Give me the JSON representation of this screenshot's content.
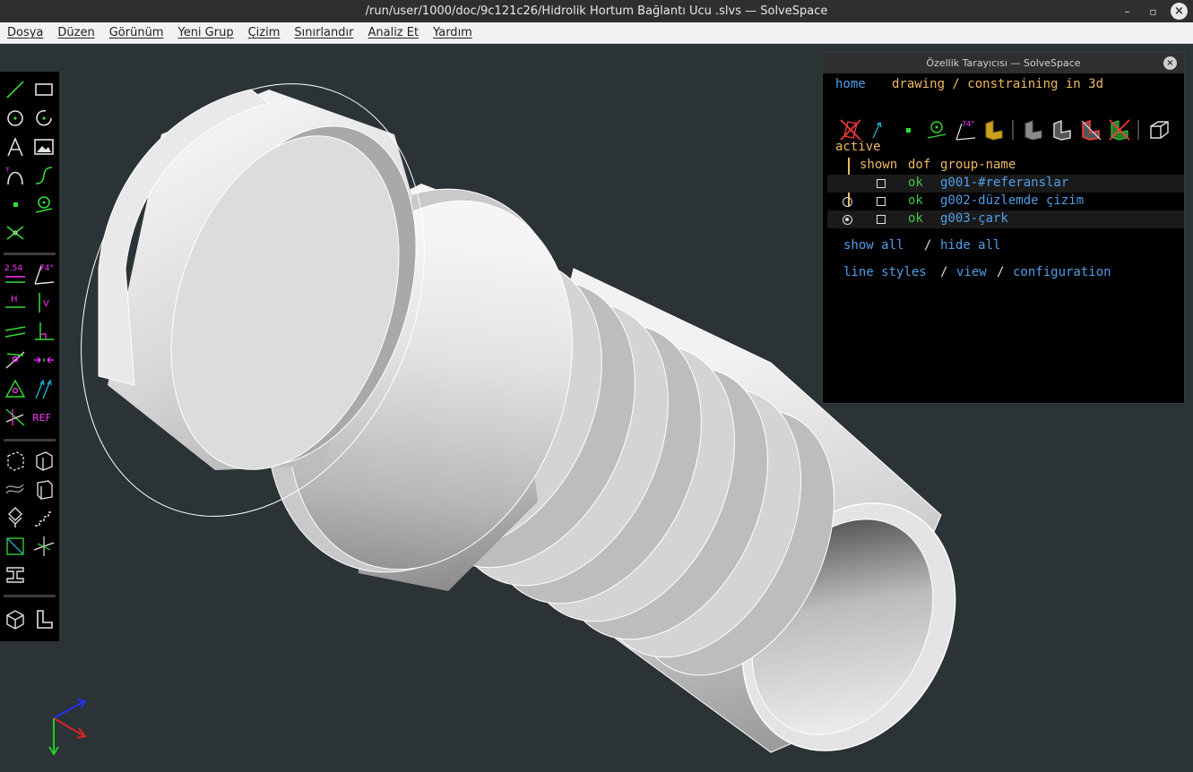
{
  "window": {
    "title": "/run/user/1000/doc/9c121c26/Hidrolik Hortum Bağlantı Ucu .slvs — SolveSpace",
    "controls": [
      "minimize-icon",
      "maximize-icon",
      "close-icon"
    ]
  },
  "menubar": {
    "items": [
      "Dosya",
      "Düzen",
      "Görünüm",
      "Yeni Grup",
      "Çizim",
      "Sınırlandır",
      "Analiz Et",
      "Yardım"
    ]
  },
  "toolbar": {
    "groups": [
      [
        "line-icon",
        "rectangle-icon",
        "circle-icon",
        "arc-icon",
        "text-icon",
        "image-icon",
        "tangent-arc-icon",
        "bezier-icon",
        "point-icon",
        "workplane-icon",
        "split-curves-icon"
      ],
      [
        "distance-constraint-icon",
        "angle-constraint-icon",
        "horizontal-icon",
        "vertical-icon",
        "parallel-icon",
        "perpendicular-icon",
        "point-on-line-icon",
        "symmetric-icon",
        "equal-icon",
        "same-orientation-icon",
        "other-angle-icon",
        "reference-icon"
      ],
      [
        "extrude-icon",
        "lathe-icon",
        "helix-icon",
        "revolve-icon",
        "step-rotate-icon",
        "step-translate-icon",
        "new-workplane-icon",
        "nearest-isometric-icon",
        "section-icon"
      ],
      [
        "assembly-icon",
        "sketch-workplane-icon"
      ]
    ],
    "labels": {
      "distance": "2.54",
      "angle": "74°",
      "horizontal": "H",
      "vertical": "V",
      "reference": "REF"
    }
  },
  "property_browser": {
    "title": "Özellik Tarayıcısı — SolveSpace",
    "nav": {
      "home": "home",
      "status": "drawing / constraining in 3d"
    },
    "toolbar_icons": [
      "show-workplanes-icon",
      "show-normals-icon",
      "show-points-icon",
      "show-construction-icon",
      "show-constraints-icon",
      "show-faces-icon",
      "show-shaded-icon",
      "show-edges-icon",
      "show-outlines-icon",
      "show-hidden-lines-icon",
      "show-mesh-icon",
      "perspective-icon"
    ],
    "active_label": "active",
    "columns": {
      "shown": "shown",
      "dof": "dof",
      "name": "group-name"
    },
    "groups": [
      {
        "name": "g001-#referanslar",
        "dof": "ok",
        "active": false,
        "radio": false,
        "shown": false
      },
      {
        "name": "g002-düzlemde çizim",
        "dof": "ok",
        "active": false,
        "radio": true,
        "shown": false
      },
      {
        "name": "g003-çark",
        "dof": "ok",
        "active": true,
        "radio": true,
        "shown": false
      }
    ],
    "links": {
      "show_all": "show all",
      "sep1": "/",
      "hide_all": "hide all",
      "line_styles": "line styles",
      "sep2": "/",
      "view": "view",
      "sep3": "/",
      "configuration": "configuration"
    }
  },
  "colors": {
    "background": "#2b3336",
    "link": "#4f9fe8",
    "orange": "#f0b964",
    "ok_green": "#41c64a",
    "magenta": "#ff33ff",
    "tool_green": "#33dd33",
    "axis_x": "#dd2222",
    "axis_y": "#22cc22",
    "axis_z": "#2233ee"
  }
}
